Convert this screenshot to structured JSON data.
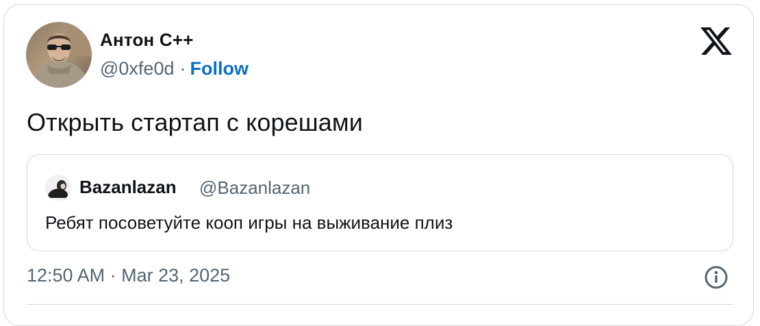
{
  "tweet": {
    "author": {
      "name": "Антон С++",
      "handle": "@0xfe0d",
      "separator": "·",
      "follow_label": "Follow",
      "avatar_icon": "user-avatar-photo"
    },
    "text": "Открыть стартап с корешами",
    "quote": {
      "author_name": "Bazanlazan",
      "author_handle": "@Bazanlazan",
      "avatar_icon": "user-avatar-photo",
      "text": "Ребят посоветуйте кооп игры на выживание плиз"
    },
    "meta": {
      "timestamp": "12:50 AM · Mar 23, 2025"
    },
    "brand_icon": "x-logo-icon",
    "info_icon": "info-icon",
    "colors": {
      "follow": "#0a6fc2",
      "secondary_text": "#536471",
      "border": "#cfd9de"
    }
  }
}
